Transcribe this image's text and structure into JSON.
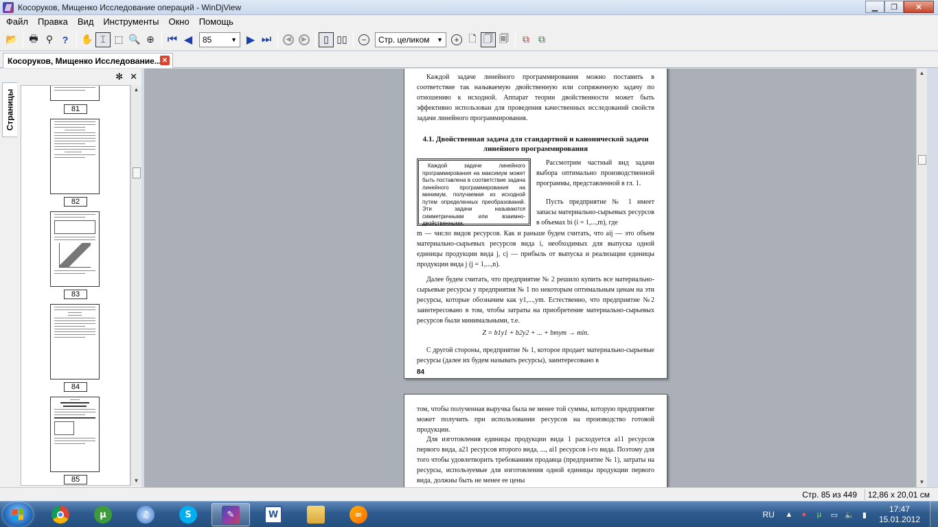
{
  "window": {
    "title": "Косоруков, Мищенко Исследование операций - WinDjView",
    "buttons": {
      "minimize": "▁",
      "maximize": "❐",
      "close": "✕"
    }
  },
  "menu": [
    "Файл",
    "Правка",
    "Вид",
    "Инструменты",
    "Окно",
    "Помощь"
  ],
  "toolbar": {
    "page_value": "85",
    "zoom_value": "Стр. целиком",
    "icons": [
      "open-icon",
      "print-icon",
      "find-icon",
      "help-icon",
      "hand-icon",
      "select-icon",
      "rect-select-icon",
      "zoom-icon",
      "magnify-icon",
      "first-page-icon",
      "prev-page-icon",
      "next-page-icon",
      "last-page-icon",
      "back-icon",
      "forward-icon",
      "single-page-icon",
      "facing-pages-icon",
      "zoom-out-icon",
      "zoom-in-icon",
      "continuous-icon",
      "layout-icon",
      "layout2-icon",
      "rotate-icon",
      "rotate2-icon"
    ]
  },
  "tab": {
    "label": "Косоруков, Мищенко Исследование...",
    "close": "✕"
  },
  "sidebar": {
    "vertical_tab": "Страницы",
    "panel_icons": {
      "settings": "✻",
      "close": "✕"
    },
    "thumbnails": [
      {
        "num": "81"
      },
      {
        "num": "82"
      },
      {
        "num": "83"
      },
      {
        "num": "84"
      },
      {
        "num": "85"
      }
    ]
  },
  "document": {
    "page1": {
      "intro": "Каждой задаче линейного программирования можно поставить в соответствие так называемую двойственную или сопряженную задачу по отношению к исходной. Аппарат теории двойственности может быть эффективно использован для проведения качественных исследований свойств задачи линейного программирования.",
      "heading": "4.1. Двойственная задача для стандартной и канонической задачи линейного программирования",
      "boxed": "Каждой задаче линейного программирования на максимум может быть поставлена в соответствие задача линейного программирования на минимум, получаемая из исходной путем определенных преобразований. Эти задачи называются симметричными или взаимно-двойственными.",
      "right1": "Рассмотрим частный вид задачи выбора оптимально производственной программы, представленной в гл. 1.",
      "right2": "Пусть предприятие № 1 имеет запасы материально-сырьевых ресурсов в объемах bi (i = 1,...,m), где",
      "para3": "m — число видов ресурсов. Как и раньше будем считать, что aij — это объем материально-сырьевых ресурсов вида i, необходимых для выпуска одной единицы продукции вида j, cj — прибыль от выпуска и реализации единицы продукции вида j (j = 1,...,n).",
      "para4": "Далее будем считать, что предприятие № 2 решило купить все материально-сырьевые ресурсы у предприятия № 1 по некоторым оптимальным ценам на эти ресурсы, которые обозначим как y1,...,ym. Естественно, что предприятие №2 заинтересовано в том, чтобы затраты на приобретение материально-сырьевых ресурсов были минимальными, т.е.",
      "formula": "Z = b1y1 + b2y2 + ... + bmym → min.",
      "para5": "С другой стороны, предприятие № 1, которое продает материально-сырьевые ресурсы (далее их будем называть ресурсы), заинтересовано в",
      "page_num": "84"
    },
    "page2": {
      "para1": "том, чтобы полученная выручка была не менее той суммы, которую предприятие может получить при использовании ресурсов на производство готовой продукции.",
      "para2": "Для изготовления единицы продукции вида 1 расходуется a11 ресурсов первого вида, a21 ресурсов второго вида, ..., ai1 ресурсов i-го вида. Поэтому для того чтобы удовлетворить требованиям продавца (предприятие № 1), затраты на ресурсы, используемые для изготовления одной единицы продукции первого вида, должны быть не менее ее цены"
    }
  },
  "status": {
    "pages": "Стр. 85 из 449",
    "size": "12,86 x 20,01 см"
  },
  "taskbar": {
    "apps": [
      "windows-start",
      "chrome",
      "utorrent",
      "itunes",
      "skype",
      "windjview",
      "word",
      "explorer",
      "other-app"
    ],
    "tray": {
      "lang": "RU",
      "time": "17:47",
      "date": "15.01.2012"
    }
  },
  "colors": {
    "taskbar": "#2e5a8e",
    "doc_bg": "#abb0b8",
    "close_red": "#c7452a"
  }
}
